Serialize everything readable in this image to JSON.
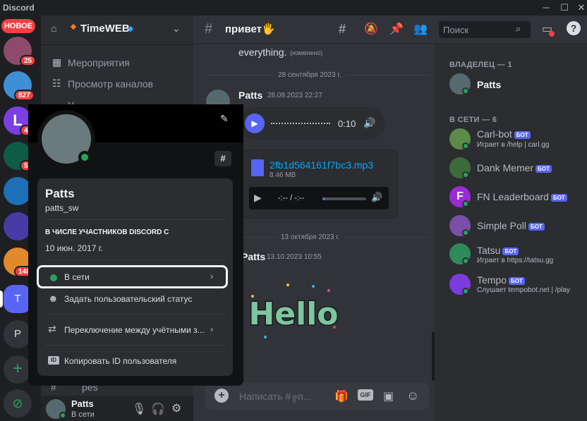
{
  "app": {
    "brand": "Discord"
  },
  "guilds": {
    "new_label": "НОВОЕ",
    "badges": [
      "25",
      "827",
      "4",
      "5",
      "148"
    ],
    "t_label": "T",
    "p_label": "P"
  },
  "server": {
    "name": "TimeWEB"
  },
  "channels": [
    {
      "label": "Мероприятия"
    },
    {
      "label": "Просмотр каналов"
    },
    {
      "label": "У"
    }
  ],
  "bottom_channel": {
    "label": "pes"
  },
  "userbar": {
    "name": "Patts",
    "status": "В сети"
  },
  "chat": {
    "channel_name": "привет🖐",
    "search_placeholder": "Поиск",
    "msg_prev_text": "everything.",
    "msg_prev_edited": "(изменено)",
    "divider1": "28 сентября 2023 г.",
    "msg1": {
      "author": "Patts",
      "time": "28.09.2023 22:27",
      "voice_time": "0:10"
    },
    "file": {
      "name": "2fb1d564161f7bc3.mp3",
      "size": "8.46 MB",
      "time": "-:-- / -:--"
    },
    "divider2": "13 октября 2023 г.",
    "msg2": {
      "author": "Patts",
      "time": "13.10.2023 10:55",
      "sticker_text": "Hello"
    },
    "input_placeholder": "Написать #╔п...",
    "gif_label": "GIF"
  },
  "members": {
    "owner_header": "ВЛАДЕЛЕЦ — 1",
    "owner": {
      "name": "Patts"
    },
    "online_header": "В СЕТИ — 6",
    "bot_tag": "БОТ",
    "list": [
      {
        "name": "Carl-bot",
        "sub": "Играет в /help | carl.gg",
        "color": "#5c8a48"
      },
      {
        "name": "Dank Memer",
        "sub": "",
        "color": "#3e6b3a"
      },
      {
        "name": "FN Leaderboard",
        "sub": "",
        "color": "#9b2bd6"
      },
      {
        "name": "Simple Poll",
        "sub": "",
        "color": "#7b4fa8"
      },
      {
        "name": "Tatsu",
        "sub": "Играет в https://tatsu.gg",
        "color": "#2e8a5a"
      },
      {
        "name": "Tempo",
        "sub": "Слушает tempobot.net | /play",
        "color": "#7c3bdd"
      }
    ]
  },
  "profile": {
    "name": "Patts",
    "username": "patts_sw",
    "member_since_label": "В ЧИСЛЕ УЧАСТНИКОВ DISCORD С",
    "member_since": "10 июн. 2017 г.",
    "menu": {
      "status": "В сети",
      "custom_status": "Задать пользовательский статус",
      "switch_accounts": "Переключение между учётными з...",
      "copy_id": "Копировать ID пользователя",
      "id_badge": "ID"
    }
  },
  "colors": {
    "accent": "#5865f2",
    "online": "#23a55a",
    "danger": "#f23f43",
    "link": "#00a8fc"
  }
}
